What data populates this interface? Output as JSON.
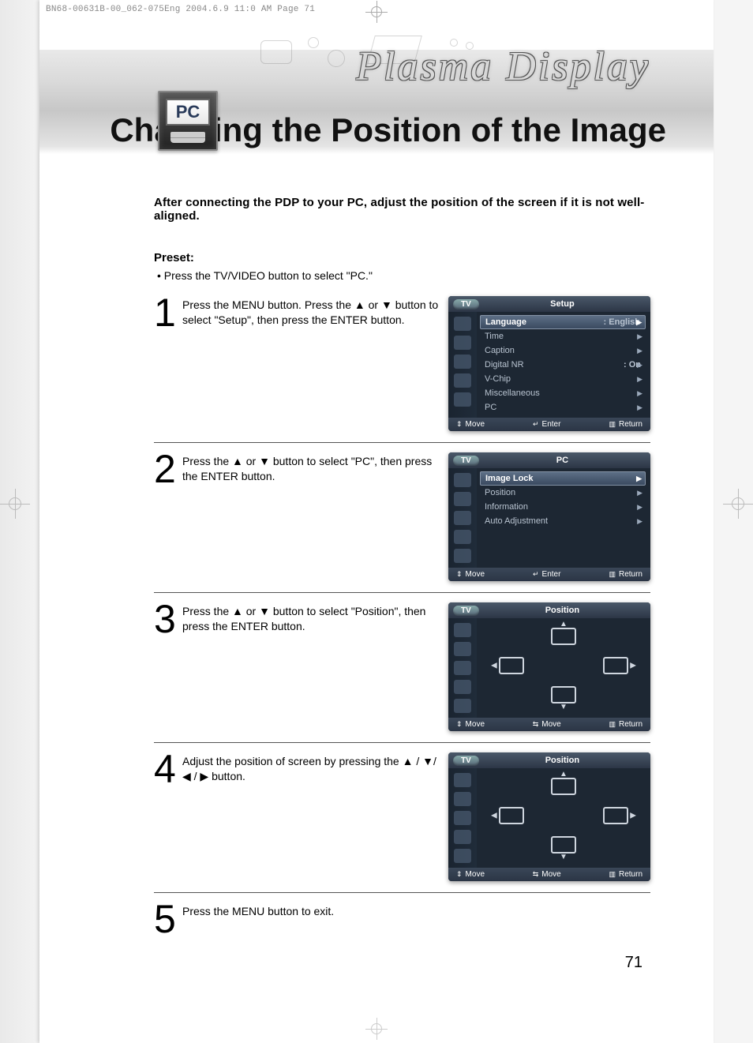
{
  "print_header": "BN68-00631B-00_062-075Eng  2004.6.9  11:0 AM  Page 71",
  "banner": {
    "script_title": "Plasma Display",
    "subtitle": "Changing the Position of the Image",
    "badge_text": "PC"
  },
  "intro": "After connecting the PDP to your PC, adjust the position of the screen if it is not well-aligned.",
  "preset": {
    "heading": "Preset:",
    "bullet": "•   Press the TV/VIDEO button to select \"PC.\""
  },
  "steps": [
    {
      "n": "1",
      "text": "Press the MENU button. Press the ▲ or ▼ button to select \"Setup\", then press the ENTER button."
    },
    {
      "n": "2",
      "text": "Press the ▲ or ▼ button to select \"PC\", then press the ENTER button."
    },
    {
      "n": "3",
      "text": "Press the ▲ or ▼ button to select \"Position\", then press the ENTER button."
    },
    {
      "n": "4",
      "text": "Adjust the position of screen by pressing the ▲ / ▼/ ◀ / ▶ button."
    },
    {
      "n": "5",
      "text": "Press the MENU button to exit."
    }
  ],
  "osd_common": {
    "tv_label": "TV",
    "footer_list": {
      "move": "Move",
      "enter": "Enter",
      "ret": "Return"
    },
    "footer_pos": {
      "move_v": "Move",
      "move_h": "Move",
      "ret": "Return"
    }
  },
  "osd1": {
    "title": "Setup",
    "items": [
      {
        "label": "Language",
        "value": ":  English"
      },
      {
        "label": "Time",
        "value": ""
      },
      {
        "label": "Caption",
        "value": ""
      },
      {
        "label": "Digital NR",
        "value": ":  On"
      },
      {
        "label": "V-Chip",
        "value": ""
      },
      {
        "label": "Miscellaneous",
        "value": ""
      },
      {
        "label": "PC",
        "value": ""
      }
    ]
  },
  "osd2": {
    "title": "PC",
    "items": [
      {
        "label": "Image Lock",
        "value": ""
      },
      {
        "label": "Position",
        "value": ""
      },
      {
        "label": "Information",
        "value": ""
      },
      {
        "label": "Auto Adjustment",
        "value": ""
      }
    ]
  },
  "osd3": {
    "title": "Position"
  },
  "osd4": {
    "title": "Position"
  },
  "page_number": "71"
}
